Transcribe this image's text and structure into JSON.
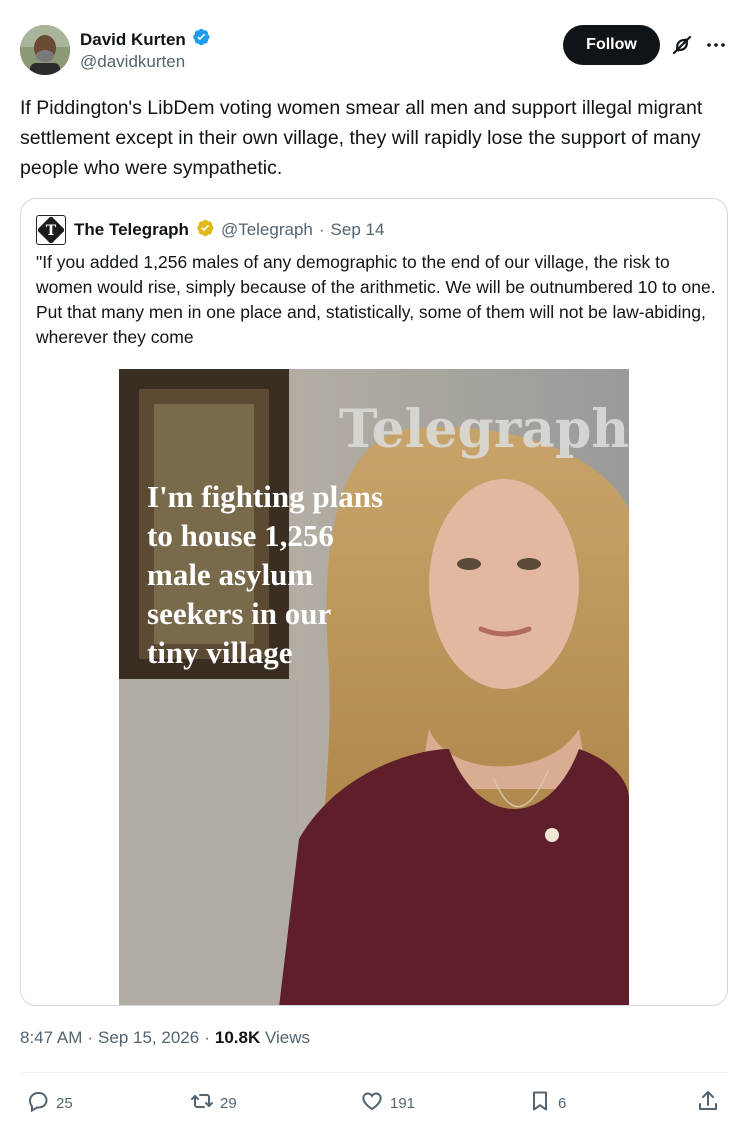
{
  "author": {
    "display_name": "David Kurten",
    "handle": "@davidkurten",
    "verified": true
  },
  "follow_label": "Follow",
  "tweet_text": "If Piddington's LibDem voting women smear all men and support illegal migrant settlement except in their own village, they will rapidly lose the support of many people who were sympathetic.",
  "quote": {
    "display_name": "The Telegraph",
    "handle": "@Telegraph",
    "separator": "·",
    "date": "Sep 14",
    "text": "\"If you added 1,256 males of any demographic to the end of our village, the risk to women would rise, simply because of the arithmetic. We will be outnumbered 10 to one. Put that many men in one place and, statistically, some of them will not be law-abiding, wherever they come",
    "image": {
      "masthead": "Telegraph",
      "headline_lines": [
        "I'm fighting plans",
        "to house 1,256",
        "male asylum",
        "seekers in our",
        "tiny village"
      ]
    }
  },
  "meta": {
    "time": "8:47 AM",
    "sep1": "·",
    "date": "Sep 15, 2026",
    "sep2": "·",
    "views_count": "10.8K",
    "views_label": "Views"
  },
  "actions": {
    "replies": "25",
    "reposts": "29",
    "likes": "191",
    "bookmarks": "6"
  },
  "colors": {
    "text": "#0f1419",
    "secondary": "#536471",
    "verified_blue": "#1d9bf0",
    "verified_gold": "#e2b719",
    "border": "#cfd9de"
  }
}
